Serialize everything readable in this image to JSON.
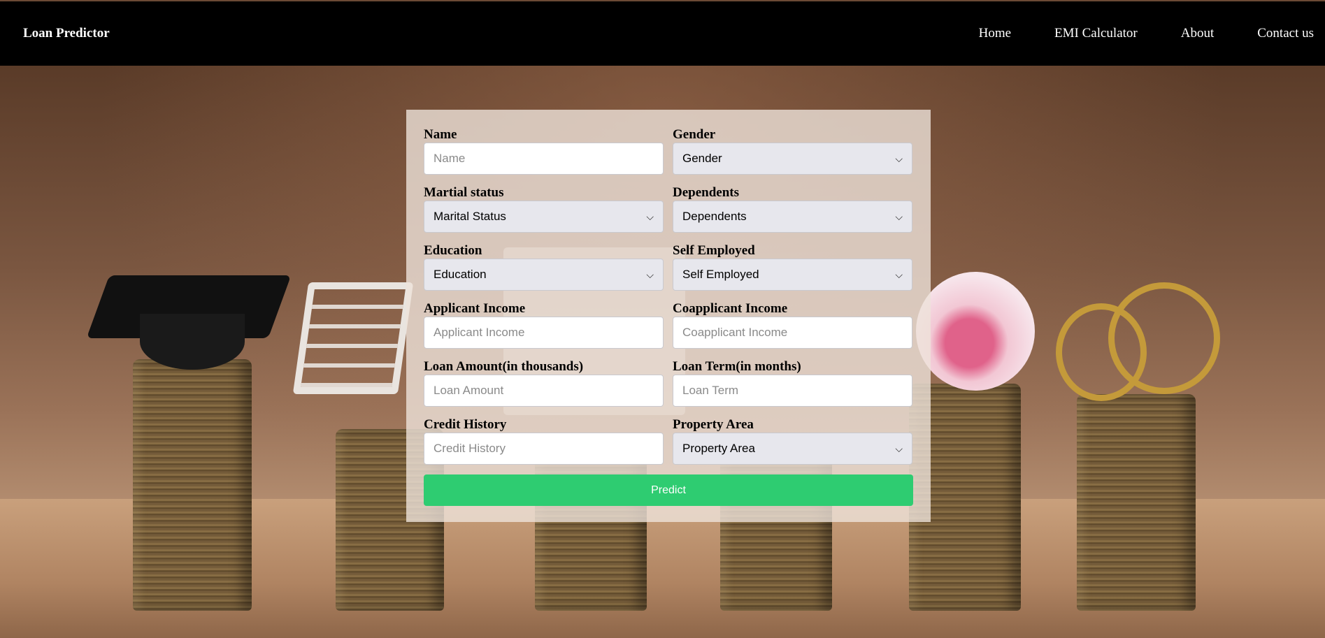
{
  "navbar": {
    "brand": "Loan Predictor",
    "links": [
      "Home",
      "EMI Calculator",
      "About",
      "Contact us"
    ]
  },
  "form": {
    "name": {
      "label": "Name",
      "placeholder": "Name"
    },
    "gender": {
      "label": "Gender",
      "selected": "Gender"
    },
    "marital": {
      "label": "Martial status",
      "selected": "Marital Status"
    },
    "dependents": {
      "label": "Dependents",
      "selected": "Dependents"
    },
    "education": {
      "label": "Education",
      "selected": "Education"
    },
    "self_employed": {
      "label": "Self Employed",
      "selected": "Self Employed"
    },
    "applicant_income": {
      "label": "Applicant Income",
      "placeholder": "Applicant Income"
    },
    "coapplicant_income": {
      "label": "Coapplicant Income",
      "placeholder": "Coapplicant Income"
    },
    "loan_amount": {
      "label": "Loan Amount(in thousands)",
      "placeholder": "Loan Amount"
    },
    "loan_term": {
      "label": "Loan Term(in months)",
      "placeholder": "Loan Term"
    },
    "credit_history": {
      "label": "Credit History",
      "placeholder": "Credit History"
    },
    "property_area": {
      "label": "Property Area",
      "selected": "Property Area"
    },
    "predict_label": "Predict"
  },
  "colors": {
    "navbar": "#000000",
    "predict_button": "#2ecc71",
    "select_bg": "#e7e7ed"
  },
  "icons": {
    "dropdown": "chevron-down-icon"
  }
}
